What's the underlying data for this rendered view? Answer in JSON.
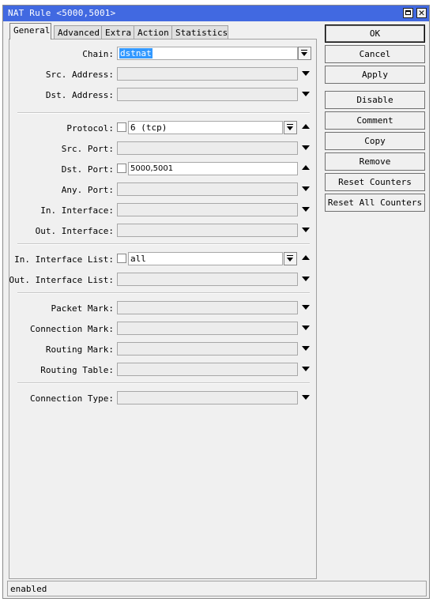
{
  "window": {
    "title": "NAT Rule <5000,5001>",
    "close_glyph": "✕"
  },
  "tabs": [
    "General",
    "Advanced",
    "Extra",
    "Action",
    "Statistics"
  ],
  "active_tab": "General",
  "form": {
    "chain": {
      "label": "Chain:",
      "value": "dstnat"
    },
    "src_address": {
      "label": "Src. Address:",
      "value": ""
    },
    "dst_address": {
      "label": "Dst. Address:",
      "value": ""
    },
    "protocol": {
      "label": "Protocol:",
      "value": "6 (tcp)",
      "negate": false
    },
    "src_port": {
      "label": "Src. Port:",
      "value": ""
    },
    "dst_port": {
      "label": "Dst. Port:",
      "value": "5000,5001",
      "negate": false
    },
    "any_port": {
      "label": "Any. Port:",
      "value": ""
    },
    "in_interface": {
      "label": "In. Interface:",
      "value": ""
    },
    "out_interface": {
      "label": "Out. Interface:",
      "value": ""
    },
    "in_interface_list": {
      "label": "In. Interface List:",
      "value": "all",
      "negate": false
    },
    "out_interface_list": {
      "label": "Out. Interface List:",
      "value": ""
    },
    "packet_mark": {
      "label": "Packet Mark:",
      "value": ""
    },
    "connection_mark": {
      "label": "Connection Mark:",
      "value": ""
    },
    "routing_mark": {
      "label": "Routing Mark:",
      "value": ""
    },
    "routing_table": {
      "label": "Routing Table:",
      "value": ""
    },
    "connection_type": {
      "label": "Connection Type:",
      "value": ""
    }
  },
  "buttons": {
    "ok": "OK",
    "cancel": "Cancel",
    "apply": "Apply",
    "disable": "Disable",
    "comment": "Comment",
    "copy": "Copy",
    "remove": "Remove",
    "reset_counters": "Reset Counters",
    "reset_all_counters": "Reset All Counters"
  },
  "status": "enabled",
  "colors": {
    "titlebar": "#4169e1",
    "selection": "#3399ff",
    "background": "#f0f0f0"
  }
}
